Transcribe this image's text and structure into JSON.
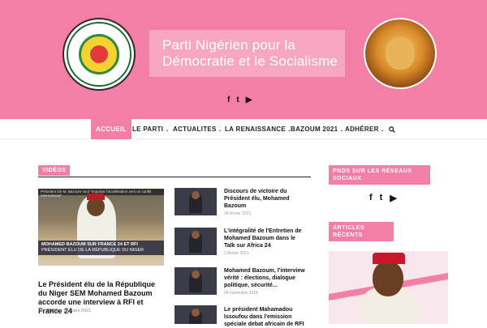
{
  "header": {
    "title_line1": "Parti Nigérien pour la",
    "title_line2": "Démocratie et le Socialisme",
    "socials": [
      "f",
      "t",
      "▶"
    ],
    "brand_color": "#f47fa6"
  },
  "nav": {
    "items": [
      {
        "label": "ACCUEIL",
        "active": true
      },
      {
        "label": "LE PARTI",
        "chevron": "⌄"
      },
      {
        "label": "ACTUALITES",
        "chevron": "⌄"
      },
      {
        "label": "LA RENAISSANCE",
        "chevron": "⌄"
      },
      {
        "label": "BAZOUM 2021",
        "chevron": "⌄"
      },
      {
        "label": "ADHÉRER",
        "chevron": "⌄"
      }
    ],
    "search_icon": "search-icon"
  },
  "videos": {
    "label": "VIDÉOS",
    "featured": {
      "thumb_topline": "Président élu M. Bazoum veut \"impulser l'accélération vers un conflit international\"",
      "thumb_ticker_1": "MOHAMED BAZOUM SUR FRANCE 24 ET RFI",
      "thumb_ticker_2": "PRÉSIDENT ÉLU DE LA RÉPUBLIQUE DU NIGER",
      "title": "Le Président élu de la République du Niger SEM Mohamed Bazoum accorde une interview à RFI et France 24",
      "by": "Par",
      "author": "PNDS",
      "date": "26 mars 2021"
    },
    "list": [
      {
        "title": "Discours de victoire du Président élu, Mohamed Bazoum",
        "date": "24 février 2021"
      },
      {
        "title": "L'intégralité de l'Entretien de Mohamed Bazoum dans le Talk sur Africa 24",
        "date": "2 février 2021"
      },
      {
        "title": "Mohamed Bazoum, l'interview vérité : élections, dialogue politique, sécurité...",
        "date": "24 novembre 2019"
      },
      {
        "title": "Le président Mahamadou Issoufou dans l'emission spéciale debat africain de RFI",
        "date": ""
      }
    ]
  },
  "sidebar": {
    "socials_label_line1": "PNDS SUR LES RÉSEAUX",
    "socials_label_line2": "SOCIAUX",
    "socials": [
      "f",
      "t",
      "▶"
    ],
    "recent_label_line1": "ARTICLES",
    "recent_label_line2": "RÉCENTS"
  }
}
